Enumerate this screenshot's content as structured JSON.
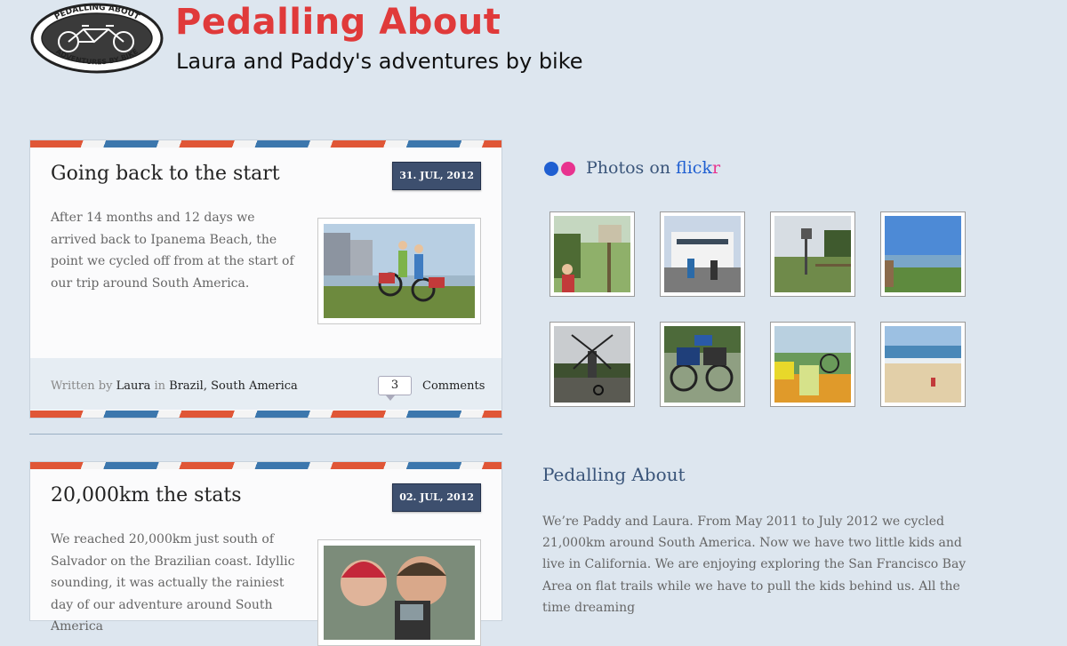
{
  "site": {
    "title": "Pedalling About",
    "tagline": "Laura and Paddy's adventures by bike",
    "logo_text_top": "PEDALLING ABOUT",
    "logo_text_bottom": "ADVENTURES BY BIKE"
  },
  "posts": [
    {
      "title": "Going back to the start",
      "date": "31. JUL, 2012",
      "excerpt": "After 14 months and 12 days we arrived back to Ipanema Beach, the point we cycled off from at the start of our trip around South America.",
      "written_by": "Written by",
      "author": "Laura",
      "in": "in",
      "categories": [
        "Brazil",
        "South America"
      ],
      "comment_count": "3",
      "comments_label": "Comments"
    },
    {
      "title": "20,000km the stats",
      "date": "02. JUL, 2012",
      "excerpt": "We reached 20,000km just south of Salvador on the Brazilian coast. Idyllic sounding, it was actually the rainiest day of our adventure around South America"
    }
  ],
  "flickr": {
    "prefix": "Photos on ",
    "word_a": "flick",
    "word_b": "r",
    "photos": [
      "photo-cyclist-signpost",
      "photo-ferry",
      "photo-field-fence",
      "photo-coast-view",
      "photo-windmill",
      "photo-loaded-bike",
      "photo-drinks-bikes",
      "photo-beach"
    ]
  },
  "about": {
    "title": "Pedalling About",
    "text": "We’re Paddy and Laura. From May 2011 to July 2012 we cycled 21,000km around South America. Now we have two little kids and live in California. We are enjoying exploring the San Francisco Bay Area on flat trails while we have to pull the kids behind us. All the time dreaming"
  },
  "colors": {
    "page_bg": "#dde6ef",
    "title_red": "#e03a3a",
    "date_badge": "#3d4f6e",
    "airmail_red": "#e05636",
    "airmail_blue": "#3c77ad",
    "flickr_blue": "#1f5fd1",
    "flickr_pink": "#e8338f"
  }
}
